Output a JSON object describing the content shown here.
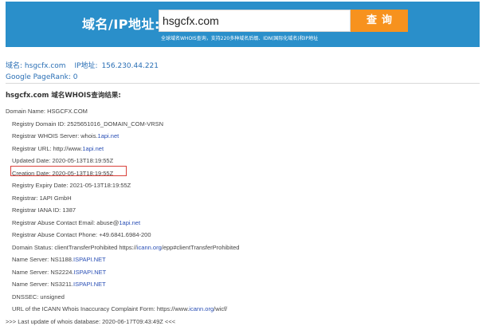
{
  "search": {
    "label": "域名/IP地址:",
    "value": "hsgcfx.com",
    "button": "查询",
    "hint": "全球域名WHOIS查询，支持220多种域名后缀、IDN(国际化域名)和IP地址"
  },
  "summary": {
    "domain_label": "域名:",
    "domain_value": "hsgcfx.com",
    "ip_label": "IP地址:",
    "ip_value": "156.230.44.221",
    "pagerank": "Google PageRank: 0"
  },
  "result_title": "hsgcfx.com 域名WHOIS查询结果:",
  "whois": [
    {
      "label": "Domain Name: HSGCFX.COM",
      "link": "",
      "suffix": ""
    },
    {
      "label": "Registry Domain ID: 2525651016_DOMAIN_COM-VRSN",
      "link": "",
      "suffix": ""
    },
    {
      "label": "Registrar WHOIS Server: whois.",
      "link": "1api.net",
      "suffix": ""
    },
    {
      "label": "Registrar URL: http://www.",
      "link": "1api.net",
      "suffix": ""
    },
    {
      "label": "Updated Date: 2020-05-13T18:19:55Z",
      "link": "",
      "suffix": ""
    },
    {
      "label": "Creation Date: 2020-05-13T18:19:55Z",
      "link": "",
      "suffix": ""
    },
    {
      "label": "Registry Expiry Date: 2021-05-13T18:19:55Z",
      "link": "",
      "suffix": ""
    },
    {
      "label": "Registrar: 1API GmbH",
      "link": "",
      "suffix": ""
    },
    {
      "label": "Registrar IANA ID: 1387",
      "link": "",
      "suffix": ""
    },
    {
      "label": "Registrar Abuse Contact Email: abuse@",
      "link": "1api.net",
      "suffix": ""
    },
    {
      "label": "Registrar Abuse Contact Phone: +49.6841.6984-200",
      "link": "",
      "suffix": ""
    },
    {
      "label": "Domain Status: clientTransferProhibited https://",
      "link": "icann.org",
      "suffix": "/epp#clientTransferProhibited"
    },
    {
      "label": "Name Server: NS1188.",
      "link": "ISPAPI.NET",
      "suffix": ""
    },
    {
      "label": "Name Server: NS2224.",
      "link": "ISPAPI.NET",
      "suffix": ""
    },
    {
      "label": "Name Server: NS3211.",
      "link": "ISPAPI.NET",
      "suffix": ""
    },
    {
      "label": "DNSSEC: unsigned",
      "link": "",
      "suffix": ""
    },
    {
      "label": "URL of the ICANN Whois Inaccuracy Complaint Form: https://www.",
      "link": "icann.org",
      "suffix": "/wicf/"
    },
    {
      "label": ">>> Last update of whois database: 2020-06-17T09:43:49Z <<<",
      "link": "",
      "suffix": ""
    }
  ],
  "colors": {
    "header_bg": "#2a8fca",
    "button_bg": "#f7921e",
    "link": "#2a4fb5",
    "highlight_border": "#d9413a"
  }
}
